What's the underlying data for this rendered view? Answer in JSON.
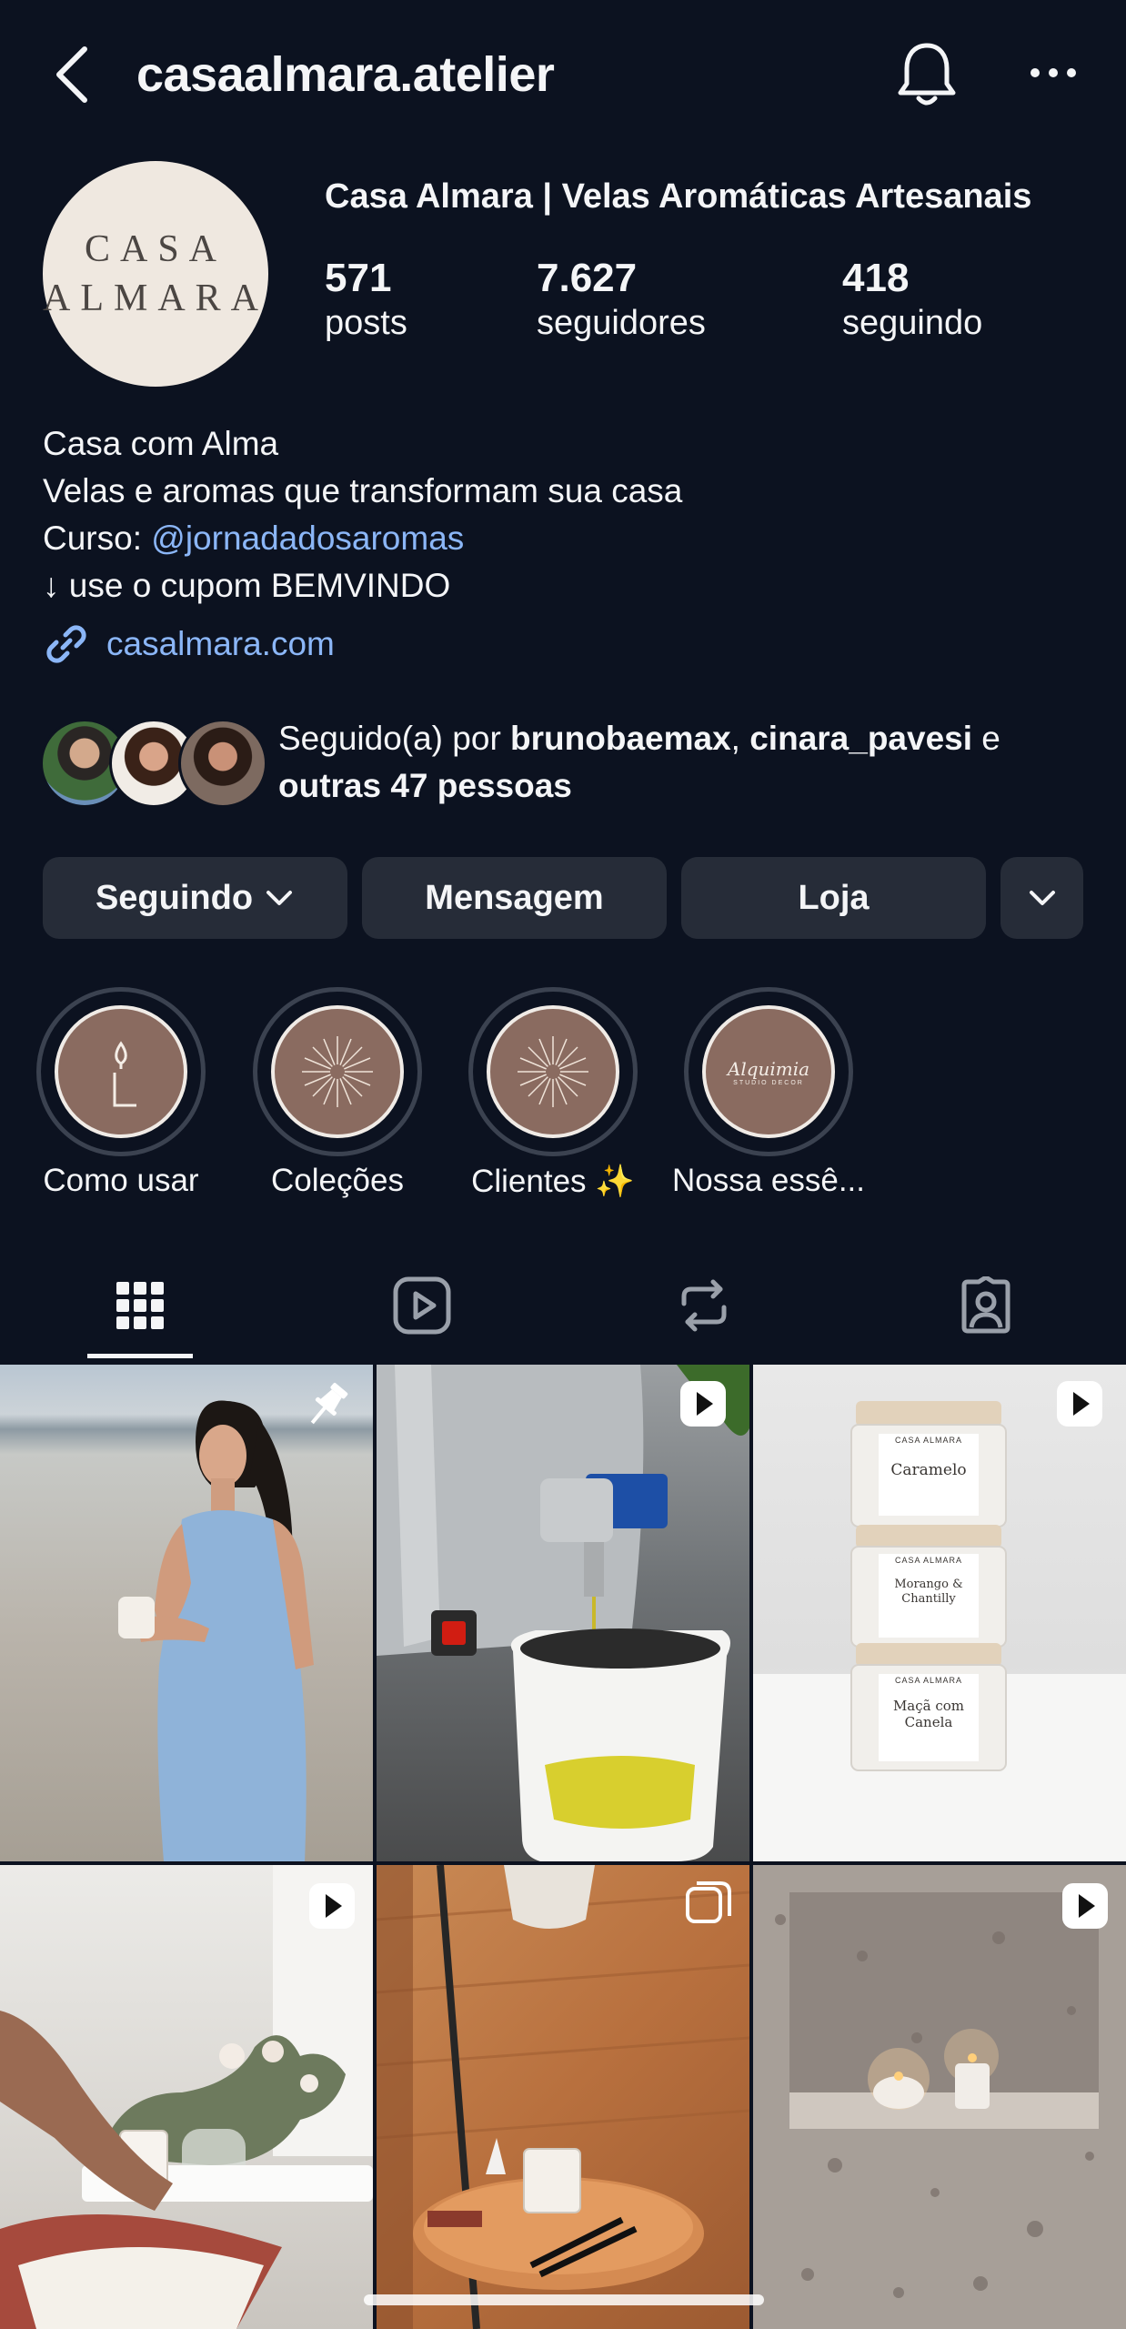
{
  "header": {
    "username": "casaalmara.atelier"
  },
  "profile": {
    "avatar_text_line1": "CASA",
    "avatar_text_line2": "ALMARA",
    "display_name": "Casa Almara | Velas Aromáticas Artesanais",
    "stats": [
      {
        "value": "571",
        "label": "posts"
      },
      {
        "value": "7.627",
        "label": "seguidores"
      },
      {
        "value": "418",
        "label": "seguindo"
      }
    ],
    "bio": {
      "line1": "Casa com Alma",
      "line2": "Velas e aromas que transformam sua casa",
      "line3_prefix": "Curso: ",
      "line3_mention": "@jornadadosaromas",
      "line4": "↓ use o cupom BEMVINDO"
    },
    "website": "casalmara.com"
  },
  "followed_by": {
    "prefix": "Seguido(a) por ",
    "user1": "brunobaemax",
    "sep": ", ",
    "user2": "cinara_pavesi",
    "and": " e",
    "others": "outras 47 pessoas"
  },
  "actions": {
    "following_label": "Seguindo",
    "message_label": "Mensagem",
    "shop_label": "Loja"
  },
  "highlights": [
    {
      "label": "Como usar"
    },
    {
      "label": "Coleções"
    },
    {
      "label": "Clientes ✨"
    },
    {
      "label": "Nossa essê..."
    }
  ],
  "highlight_logo_text": "Alquimia",
  "highlight_logo_sub": "STUDIO DECOR",
  "tabs": [
    {
      "icon": "grid-icon",
      "active": true
    },
    {
      "icon": "reels-icon",
      "active": false
    },
    {
      "icon": "repost-icon",
      "active": false
    },
    {
      "icon": "tagged-icon",
      "active": false
    }
  ],
  "posts": {
    "jar1_brand": "CASA ALMARA",
    "jar1_name": "Caramelo",
    "jar2_brand": "CASA ALMARA",
    "jar2_name": "Morango & Chantilly",
    "jar3_brand": "CASA ALMARA",
    "jar3_name": "Maçã com Canela"
  },
  "colors": {
    "background": "#0c1220",
    "button": "#262c38",
    "link": "#8bb6f7",
    "highlight_fill": "#8a6b60"
  }
}
